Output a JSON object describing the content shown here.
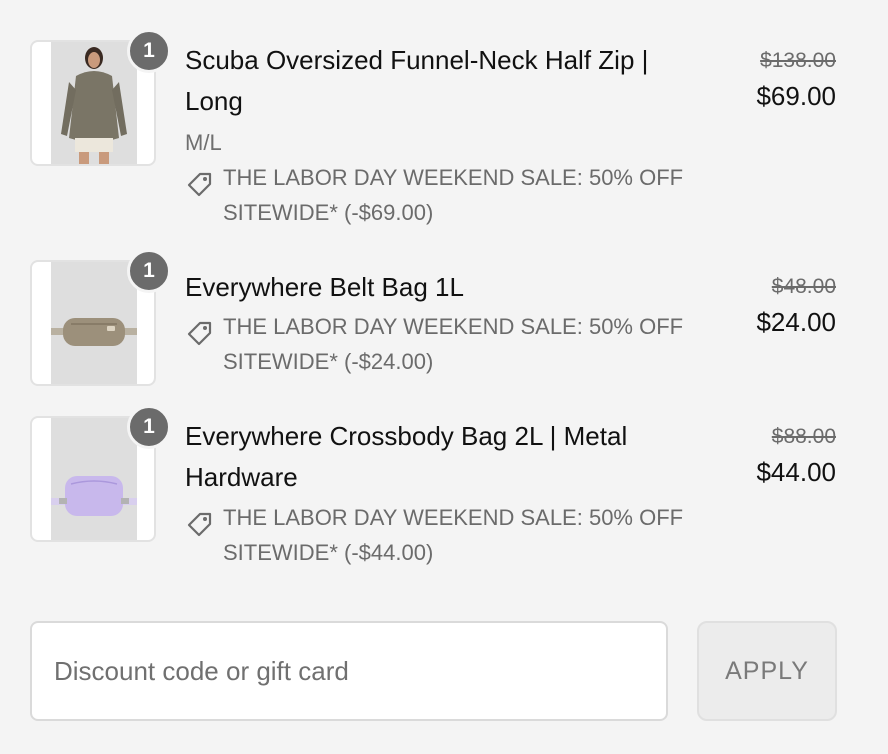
{
  "items": [
    {
      "quantity": "1",
      "name": "Scuba Oversized Funnel-Neck Half Zip | Long",
      "variant": "M/L",
      "discount": "THE LABOR DAY WEEKEND SALE: 50% OFF SITEWIDE* (-$69.00)",
      "original_price": "$138.00",
      "price": "$69.00",
      "product_color": "#7a7566"
    },
    {
      "quantity": "1",
      "name": "Everywhere Belt Bag 1L",
      "variant": "",
      "discount": "THE LABOR DAY WEEKEND SALE: 50% OFF SITEWIDE* (-$24.00)",
      "original_price": "$48.00",
      "price": "$24.00",
      "product_color": "#9c907b"
    },
    {
      "quantity": "1",
      "name": "Everywhere Crossbody Bag 2L | Metal Hardware",
      "variant": "",
      "discount": "THE LABOR DAY WEEKEND SALE: 50% OFF SITEWIDE* (-$44.00)",
      "original_price": "$88.00",
      "price": "$44.00",
      "product_color": "#c8b8ec"
    }
  ],
  "discount_field": {
    "placeholder": "Discount code or gift card",
    "value": ""
  },
  "apply_button": {
    "label": "APPLY"
  },
  "colors": {
    "page_background": "#f4f4f4",
    "badge": "#6b6b6b",
    "muted_text": "#6b6b6b"
  }
}
